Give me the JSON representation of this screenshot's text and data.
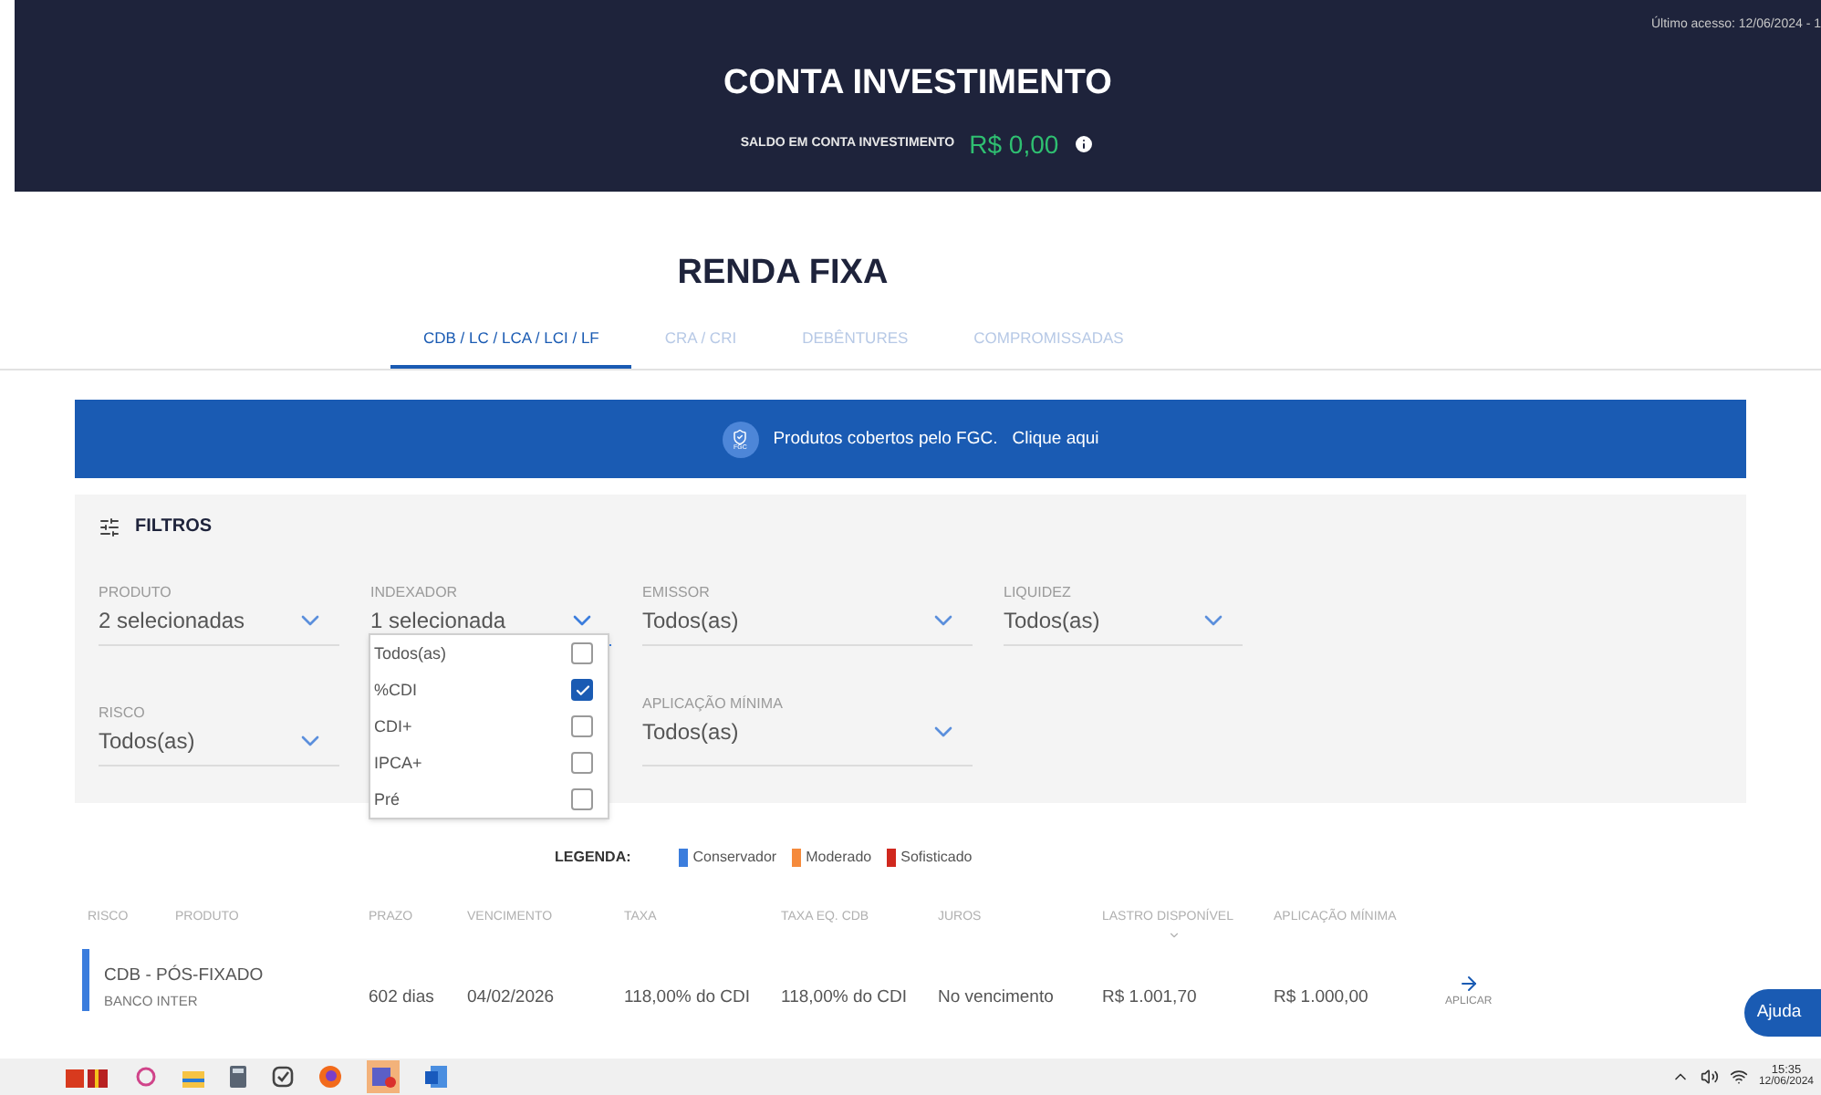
{
  "header": {
    "last_access": "Último acesso: 12/06/2024 - 1",
    "title": "CONTA INVESTIMENTO",
    "balance_label": "SALDO EM CONTA INVESTIMENTO",
    "balance": "R$ 0,00"
  },
  "section_title": "RENDA FIXA",
  "tabs": [
    {
      "label": "CDB / LC / LCA / LCI / LF",
      "selected": true
    },
    {
      "label": "CRA / CRI",
      "selected": false
    },
    {
      "label": "DEBÊNTURES",
      "selected": false
    },
    {
      "label": "COMPROMISSADAS",
      "selected": false
    }
  ],
  "banner": {
    "badge": "FGC",
    "text": "Produtos cobertos pelo FGC.",
    "link": "Clique aqui"
  },
  "filters": {
    "title": "FILTROS",
    "fields": [
      {
        "label": "PRODUTO",
        "value": "2 selecionadas",
        "expanded": false
      },
      {
        "label": "INDEXADOR",
        "value": "1 selecionada",
        "expanded": true
      },
      {
        "label": "EMISSOR",
        "value": "Todos(as)",
        "expanded": false
      },
      {
        "label": "LIQUIDEZ",
        "value": "Todos(as)",
        "expanded": false
      },
      {
        "label": "RISCO",
        "value": "Todos(as)",
        "expanded": false
      },
      {
        "label": "APLICAÇÃO MÍNIMA",
        "value": "Todos(as)",
        "expanded": false
      }
    ],
    "dropdown_options": [
      {
        "label": "Todos(as)",
        "checked": false
      },
      {
        "label": "%CDI",
        "checked": true
      },
      {
        "label": "CDI+",
        "checked": false
      },
      {
        "label": "IPCA+",
        "checked": false
      },
      {
        "label": "Pré",
        "checked": false
      }
    ]
  },
  "legend": {
    "title": "LEGENDA:",
    "items": [
      {
        "label": "Conservador",
        "color": "#3b7ddd"
      },
      {
        "label": "Moderado",
        "color": "#f58a3c"
      },
      {
        "label": "Sofisticado",
        "color": "#d0281e"
      }
    ]
  },
  "table": {
    "columns": [
      "RISCO",
      "PRODUTO",
      "PRAZO",
      "VENCIMENTO",
      "TAXA",
      "TAXA EQ. CDB",
      "JUROS",
      "LASTRO DISPONÍVEL",
      "APLICAÇÃO MÍNIMA"
    ],
    "rows": [
      {
        "color": "#3b7ddd",
        "product": "CDB - PÓS-FIXADO",
        "issuer": "BANCO INTER",
        "term": "602 dias",
        "maturity": "04/02/2026",
        "rate": "118,00% do CDI",
        "rate_cdb": "118,00% do CDI",
        "interest": "No vencimento",
        "backing": "R$ 1.001,70",
        "minimum": "R$ 1.000,00",
        "action": "APLICAR"
      }
    ]
  },
  "help_button": "Ajuda",
  "taskbar": {
    "time": "15:35",
    "date": "12/06/2024"
  }
}
